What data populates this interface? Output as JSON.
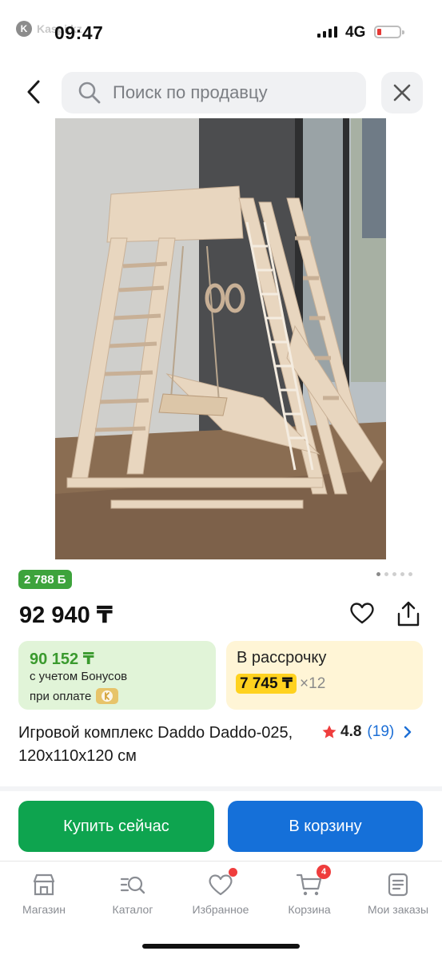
{
  "status_bar": {
    "app_logo_text": "Kaspi.kz",
    "time": "09:47",
    "network": "4G",
    "battery_level": 0.1
  },
  "header": {
    "search_placeholder": "Поиск по продавцу"
  },
  "product": {
    "image_alt": "Игровой комплекс Daddo",
    "gallery": {
      "count": 5,
      "active_index": 0
    },
    "bonus_badge": "2 788 Б",
    "price": "92 940 ₸",
    "bonus_card": {
      "amount": "90 152 ₸",
      "line1": "с учетом Бонусов",
      "line2": "при оплате"
    },
    "installment_card": {
      "title": "В рассрочку",
      "monthly": "7 745 ₸",
      "months": "×12"
    },
    "title": "Игровой комплекс Daddo Daddo-025, 120х110х120 см",
    "rating": "4.8",
    "reviews": "(19)"
  },
  "actions": {
    "buy_now": "Купить сейчас",
    "add_to_cart": "В корзину"
  },
  "tabbar": {
    "items": [
      {
        "label": "Магазин",
        "icon": "shop-icon"
      },
      {
        "label": "Каталог",
        "icon": "catalog-search-icon"
      },
      {
        "label": "Избранное",
        "icon": "heart-icon",
        "dot": true
      },
      {
        "label": "Корзина",
        "icon": "cart-icon",
        "badge": "4"
      },
      {
        "label": "Мои заказы",
        "icon": "orders-icon"
      }
    ]
  },
  "colors": {
    "buy_button": "#0ea44f",
    "cart_button": "#1570d9",
    "bonus_green": "#3da33c",
    "installment_highlight": "#ffd21f",
    "badge_red": "#ef3d3d",
    "link_blue": "#1d6fd6"
  }
}
